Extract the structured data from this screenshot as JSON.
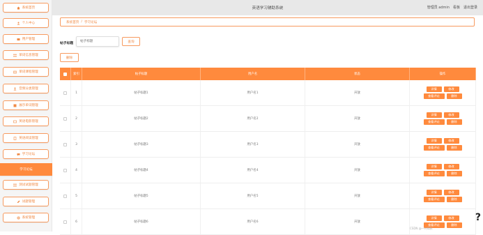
{
  "app": {
    "title": "英语学习辅助系统"
  },
  "header": {
    "admin_label": "管理员 admin",
    "dashboard_label": "看板",
    "logout_label": "退出登录"
  },
  "sidebar": {
    "items": [
      {
        "label": "系统首页",
        "icon": "home-icon"
      },
      {
        "label": "个人中心",
        "icon": "user-icon"
      },
      {
        "label": "用户管理",
        "icon": "users-icon"
      },
      {
        "label": "单词信息管理",
        "icon": "grid-icon"
      },
      {
        "label": "单词课程管理",
        "icon": "book-icon"
      },
      {
        "label": "音频分类管理",
        "icon": "user-icon"
      },
      {
        "label": "展示单词管理",
        "icon": "list-icon"
      },
      {
        "label": "英语电影管理",
        "icon": "film-icon"
      },
      {
        "label": "英语阅读管理",
        "icon": "doc-icon"
      },
      {
        "label": "学习论坛",
        "icon": "forum-icon"
      },
      {
        "label": "学习论坛",
        "icon": "",
        "active": true
      },
      {
        "label": "测试试题管理",
        "icon": "grid-icon"
      },
      {
        "label": "试题管理",
        "icon": "edit-icon"
      },
      {
        "label": "系统管理",
        "icon": "gear-icon"
      }
    ]
  },
  "breadcrumb": {
    "home": "系统首页",
    "separator": "/",
    "current": "学习论坛"
  },
  "search": {
    "label": "帖子标题",
    "placeholder": "帖子标题",
    "button": "查询"
  },
  "toolbar": {
    "delete_label": "删除"
  },
  "table": {
    "headers": {
      "index": "索引",
      "title": "帖子标题",
      "user": "用户名",
      "status": "状态",
      "ops": "操作"
    },
    "rows": [
      {
        "index": "1",
        "title": "帖子标题1",
        "user": "用户名1",
        "status": "开放"
      },
      {
        "index": "2",
        "title": "帖子标题2",
        "user": "用户名2",
        "status": "开放"
      },
      {
        "index": "3",
        "title": "帖子标题3",
        "user": "用户名3",
        "status": "开放"
      },
      {
        "index": "4",
        "title": "帖子标题4",
        "user": "用户名4",
        "status": "开放"
      },
      {
        "index": "5",
        "title": "帖子标题5",
        "user": "用户名5",
        "status": "开放"
      },
      {
        "index": "6",
        "title": "帖子标题6",
        "user": "用户名6",
        "status": "开放"
      }
    ],
    "ops": {
      "detail": "详情",
      "edit": "修改",
      "comments": "查看评论",
      "delete": "删除"
    }
  },
  "help": {
    "symbol": "?"
  },
  "watermark": "CSDN @一叶知秋"
}
